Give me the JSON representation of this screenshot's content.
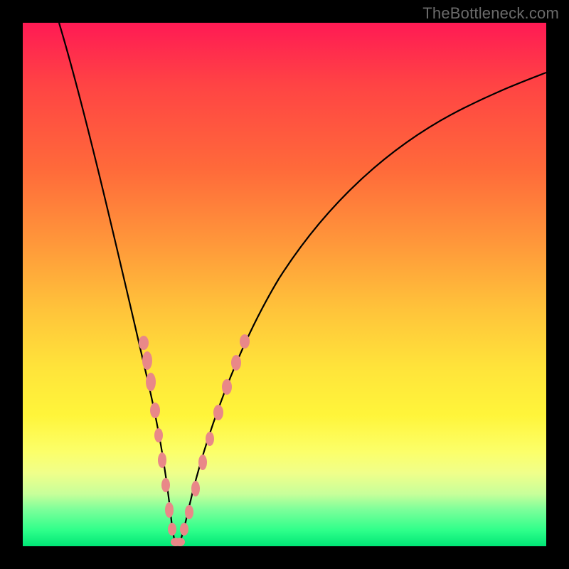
{
  "watermark": {
    "text": "TheBottleneck.com"
  },
  "chart_data": {
    "type": "line",
    "title": "",
    "xlabel": "",
    "ylabel": "",
    "xlim": [
      0,
      100
    ],
    "ylim": [
      0,
      100
    ],
    "series": [
      {
        "name": "bottleneck-curve",
        "x": [
          7,
          10,
          14,
          18,
          21,
          23,
          25,
          26.5,
          27.5,
          28.5,
          30,
          33,
          37,
          43,
          51,
          60,
          70,
          82,
          95,
          100
        ],
        "y": [
          100,
          88,
          74,
          58,
          44,
          33,
          22,
          12,
          4,
          0,
          4,
          14,
          26,
          40,
          54,
          66,
          76,
          84,
          90,
          92
        ]
      }
    ],
    "markers_left": {
      "name": "highlight-left",
      "x": [
        21.5,
        22.2,
        22.8,
        23.6,
        24.4,
        25.0,
        25.6,
        26.2,
        26.8,
        27.3
      ],
      "y": [
        41,
        37,
        33,
        28,
        23,
        19,
        15,
        11,
        7,
        4
      ]
    },
    "markers_right": {
      "name": "highlight-right",
      "x": [
        29.5,
        30.2,
        30.9,
        31.8,
        33.0,
        34.3,
        35.5,
        36.8,
        38.0,
        39.3
      ],
      "y": [
        3,
        6,
        9,
        13,
        18,
        22,
        27,
        31,
        36,
        41
      ]
    },
    "background_note": "vertical rainbow gradient red(top) to green(bottom)"
  }
}
